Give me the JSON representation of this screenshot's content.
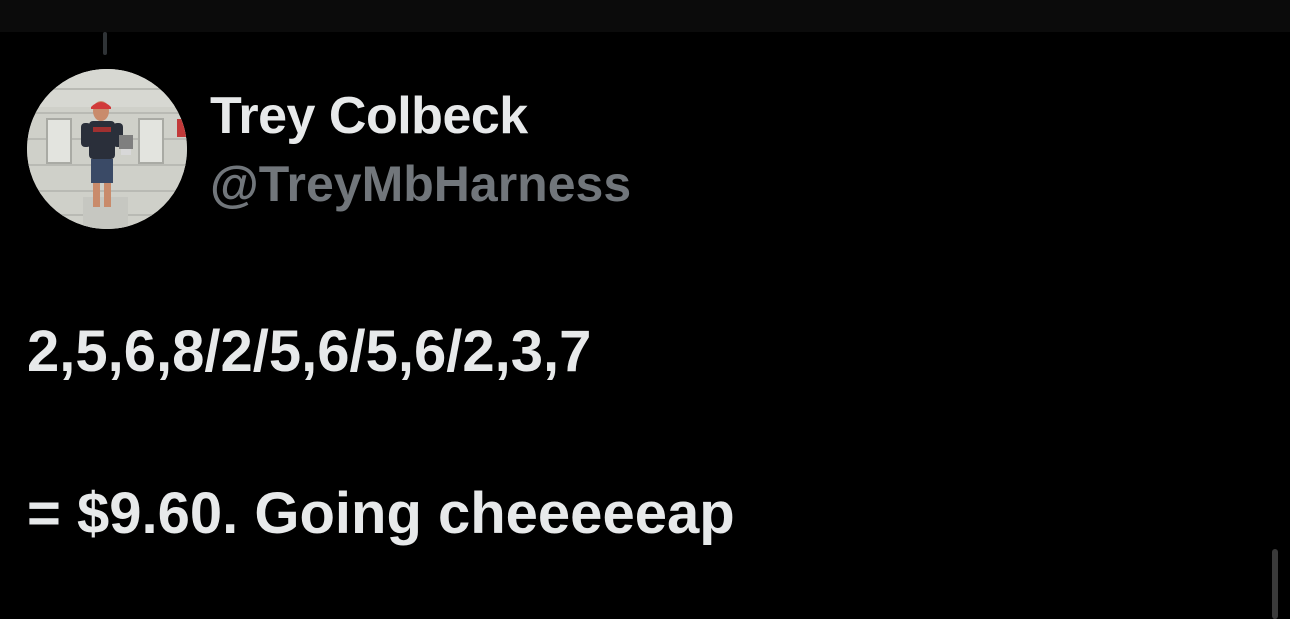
{
  "author": {
    "display_name": "Trey Colbeck",
    "handle": "@TreyMbHarness",
    "avatar_icon": "profile-photo"
  },
  "tweet": {
    "lines": [
      "2,5,6,8/2/5,6/5,6/2,3,7",
      "= $9.60. Going cheeeeeap"
    ]
  },
  "colors": {
    "background": "#000000",
    "primary_text": "#e7e9ea",
    "secondary_text": "#71767b"
  }
}
